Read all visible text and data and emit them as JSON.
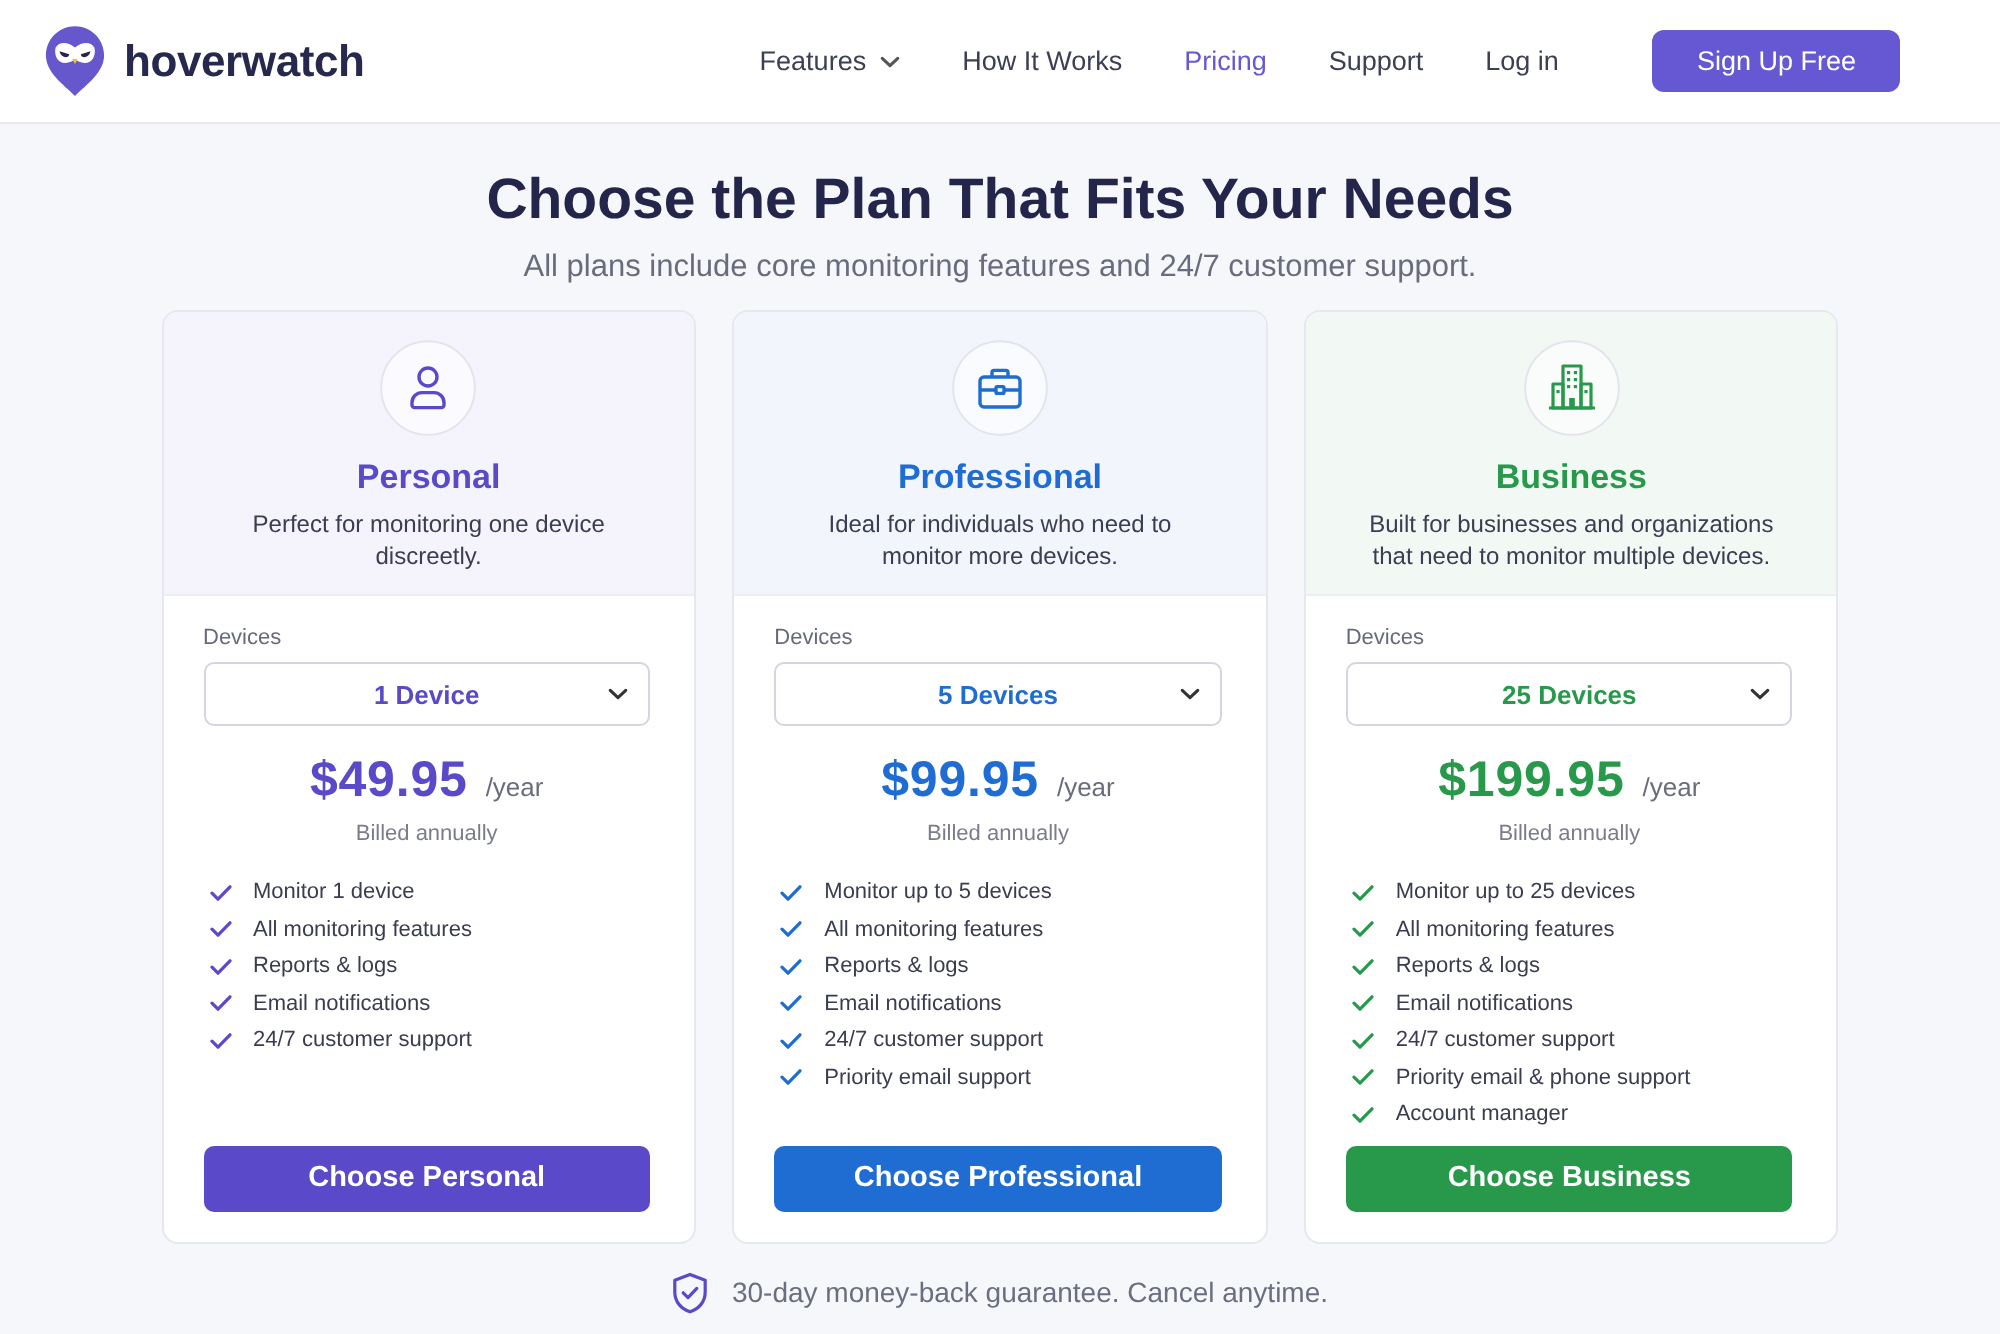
{
  "header": {
    "logo": {
      "wordmark": "hoverwatch"
    },
    "nav": [
      {
        "label": "Features",
        "dropdown": true,
        "selected": false
      },
      {
        "label": "How It Works",
        "dropdown": false,
        "selected": false
      },
      {
        "label": "Pricing",
        "dropdown": false,
        "selected": true
      },
      {
        "label": "Support",
        "dropdown": false,
        "selected": false
      },
      {
        "label": "Log in",
        "dropdown": false,
        "selected": false
      }
    ],
    "cta_button": "Sign Up Free"
  },
  "hero": {
    "title": "Choose the Plan That Fits Your Needs",
    "subtitle": "All plans include core monitoring features and 24/7 customer support."
  },
  "plans": [
    {
      "name": "Personal",
      "color": "#5a49c9",
      "description": "Perfect for monitoring one device discreetly.",
      "devices": {
        "label": "Devices",
        "value": "1 Device"
      },
      "price": "$49.95",
      "period": "/year",
      "billing": "Billed annually",
      "features": [
        "Monitor 1 device",
        "All monitoring features",
        "Reports & logs",
        "Email notifications",
        "24/7 customer support"
      ],
      "button": "Choose Personal"
    },
    {
      "name": "Professional",
      "color": "#1f6dd2",
      "description": "Ideal for individuals who need to monitor more devices.",
      "devices": {
        "label": "Devices",
        "value": "5 Devices"
      },
      "price": "$99.95",
      "period": "/year",
      "billing": "Billed annually",
      "features": [
        "Monitor up to 5 devices",
        "All monitoring features",
        "Reports & logs",
        "Email notifications",
        "24/7 customer support",
        "Priority email support"
      ],
      "button": "Choose Professional"
    },
    {
      "name": "Business",
      "color": "#28994b",
      "description": "Built for businesses and organizations that need to monitor multiple devices.",
      "devices": {
        "label": "Devices",
        "value": "25 Devices"
      },
      "price": "$199.95",
      "period": "/year",
      "billing": "Billed annually",
      "features": [
        "Monitor up to 25 devices",
        "All monitoring features",
        "Reports & logs",
        "Email notifications",
        "24/7 customer support",
        "Priority email & phone support",
        "Account manager"
      ],
      "button": "Choose Business"
    }
  ],
  "guarantee": {
    "text": "30-day money-back guarantee. Cancel anytime."
  }
}
